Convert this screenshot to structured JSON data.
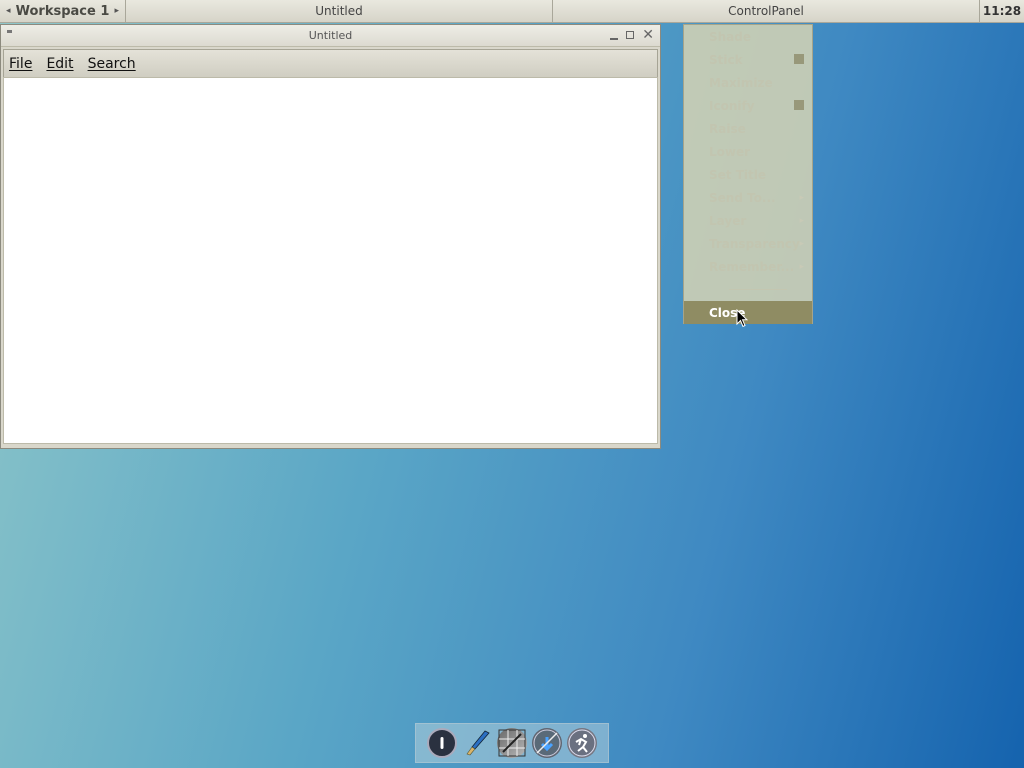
{
  "toolbar": {
    "workspace_label": "Workspace 1",
    "prev_arrow": "◂",
    "next_arrow": "▸",
    "tasks": [
      {
        "label": "Untitled"
      },
      {
        "label": "ControlPanel"
      }
    ],
    "clock": "11:28"
  },
  "window": {
    "title": "Untitled",
    "menus": [
      {
        "label": "File"
      },
      {
        "label": "Edit"
      },
      {
        "label": "Search"
      }
    ]
  },
  "context_menu": {
    "items": [
      {
        "label": "Shade",
        "has_box": false,
        "has_submenu": false
      },
      {
        "label": "Stick",
        "has_box": true,
        "has_submenu": false
      },
      {
        "label": "Maximize",
        "has_box": false,
        "has_submenu": false
      },
      {
        "label": "Iconify",
        "has_box": true,
        "has_submenu": false
      },
      {
        "label": "Raise",
        "has_box": false,
        "has_submenu": false
      },
      {
        "label": "Lower",
        "has_box": false,
        "has_submenu": false
      },
      {
        "label": "Set Title",
        "has_box": false,
        "has_submenu": false
      },
      {
        "label": "Send To...",
        "has_box": false,
        "has_submenu": true
      },
      {
        "label": "Layer",
        "has_box": false,
        "has_submenu": true
      },
      {
        "label": "Transparency",
        "has_box": false,
        "has_submenu": true
      },
      {
        "label": "Remember...",
        "has_box": false,
        "has_submenu": true
      }
    ],
    "close_label": "Close",
    "submenu_glyph": "▸"
  },
  "dock": {
    "icons": [
      {
        "name": "power-icon"
      },
      {
        "name": "paintbrush-icon"
      },
      {
        "name": "screenshot-grid-icon"
      },
      {
        "name": "download-icon"
      },
      {
        "name": "runner-icon"
      }
    ]
  }
}
